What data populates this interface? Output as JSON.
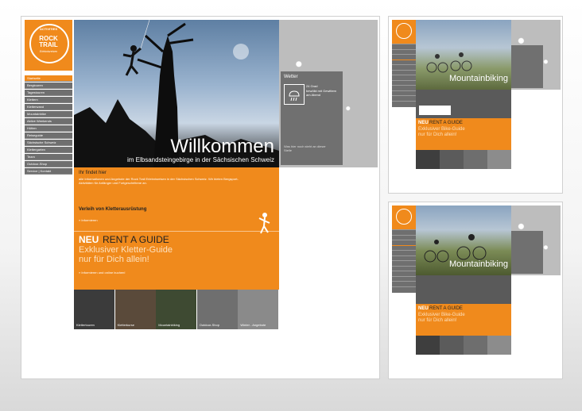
{
  "main": {
    "logo": {
      "text_top": "ACTIVITIES",
      "text_main": "ROCK TRAIL",
      "text_sub": "Erlebnisreisen"
    },
    "nav": [
      "Startseite",
      "Bergtouren",
      "Tagestouren",
      "Klettern",
      "Kletterwand",
      "Mountainbike",
      "Aktive Weekends",
      "Hütten",
      "Reiseguide",
      "Sächsische Schweiz",
      "Klettergarten",
      "Team",
      "Outdoor-Shop",
      "Service | Kontakt"
    ],
    "hero": {
      "title": "Willkommen",
      "subtitle": "im Elbsandsteingebirge in der Sächsischen Schweiz"
    },
    "weather": {
      "label": "Wetter",
      "temp": "24 Grad",
      "desc": "bewölkt mit Gewittern am Abend"
    },
    "weather_more": "Was hier noch steht an dieser Stelle",
    "intro_heading": "Ihr findet hier",
    "intro_text": "alle Informationen und Angebote der Rock Trail Erlebnisreisen in der Sächsischen Schweiz. Wir bieten Bergsport-Aktivitäten für Anfänger und Fortgeschrittene an.",
    "rental": {
      "heading": "Verleih von Kletterausrüstung",
      "link": "Informieren"
    },
    "guide": {
      "neu": "NEU",
      "title": "RENT A GUIDE",
      "line1": "Exklusiver Kletter-Guide",
      "line2": "nur für Dich allein!",
      "link": "Informieren und online buchen!"
    },
    "thumbs": [
      "Klettertouren",
      "Kletterkurse",
      "Mountainbiking",
      "Outdoor-Shop",
      "Winter - Angebote"
    ]
  },
  "preview1": {
    "hero_title": "Mountainbiking",
    "guide_neu": "NEU",
    "guide_title": "RENT A GUIDE",
    "guide_line1": "Exklusiver Bike-Guide",
    "guide_line2": "nur für Dich allein!"
  },
  "preview2": {
    "hero_title": "Mountainbiking",
    "guide_neu": "NEU",
    "guide_title": "RENT A GUIDE",
    "guide_line1": "Exklusiver Bike-Guide",
    "guide_line2": "nur für Dich allein!"
  },
  "colors": {
    "accent": "#f08a1c",
    "gray": "#6f6f6f",
    "dark": "#2d2d2d"
  }
}
